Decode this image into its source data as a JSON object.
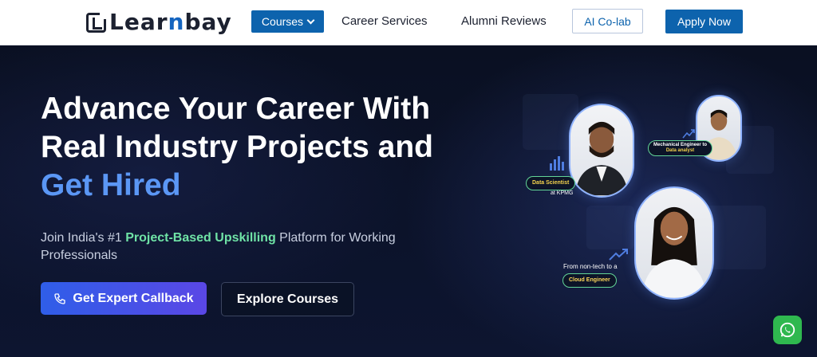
{
  "header": {
    "logo_text_a": "Lear",
    "logo_text_b": "n",
    "logo_text_c": "bay",
    "nav": {
      "courses_label": "Courses",
      "career_label": "Career Services",
      "alumni_label": "Alumni Reviews",
      "colab_label": "AI Co-lab",
      "apply_label": "Apply Now"
    }
  },
  "hero": {
    "title_line1": "Advance Your Career With",
    "title_line2": "Real Industry Projects and",
    "title_highlight": "Get Hired",
    "subtitle_pre": "Join India's #1 ",
    "subtitle_highlight": "Project-Based Upskilling",
    "subtitle_post": " Platform for Working Professionals",
    "cta_callback": "Get Expert Callback",
    "cta_explore": "Explore Courses"
  },
  "testimonials": {
    "person1_role": "Data Scientist",
    "person1_company": "at KPMG",
    "person2_role_line1": "Mechanical Engineer to",
    "person2_role_line2": "Data analyst",
    "person3_caption": "From non-tech to a",
    "person3_role": "Cloud Engineer"
  },
  "colors": {
    "brand_blue": "#0d63ad",
    "highlight_blue": "#5b97f5",
    "highlight_green": "#6fe3a6",
    "whatsapp_green": "#2fb84f"
  },
  "icons": [
    "logo-mark-icon",
    "chevron-down-icon",
    "phone-icon",
    "bar-chart-icon",
    "trend-up-icon",
    "whatsapp-icon"
  ]
}
